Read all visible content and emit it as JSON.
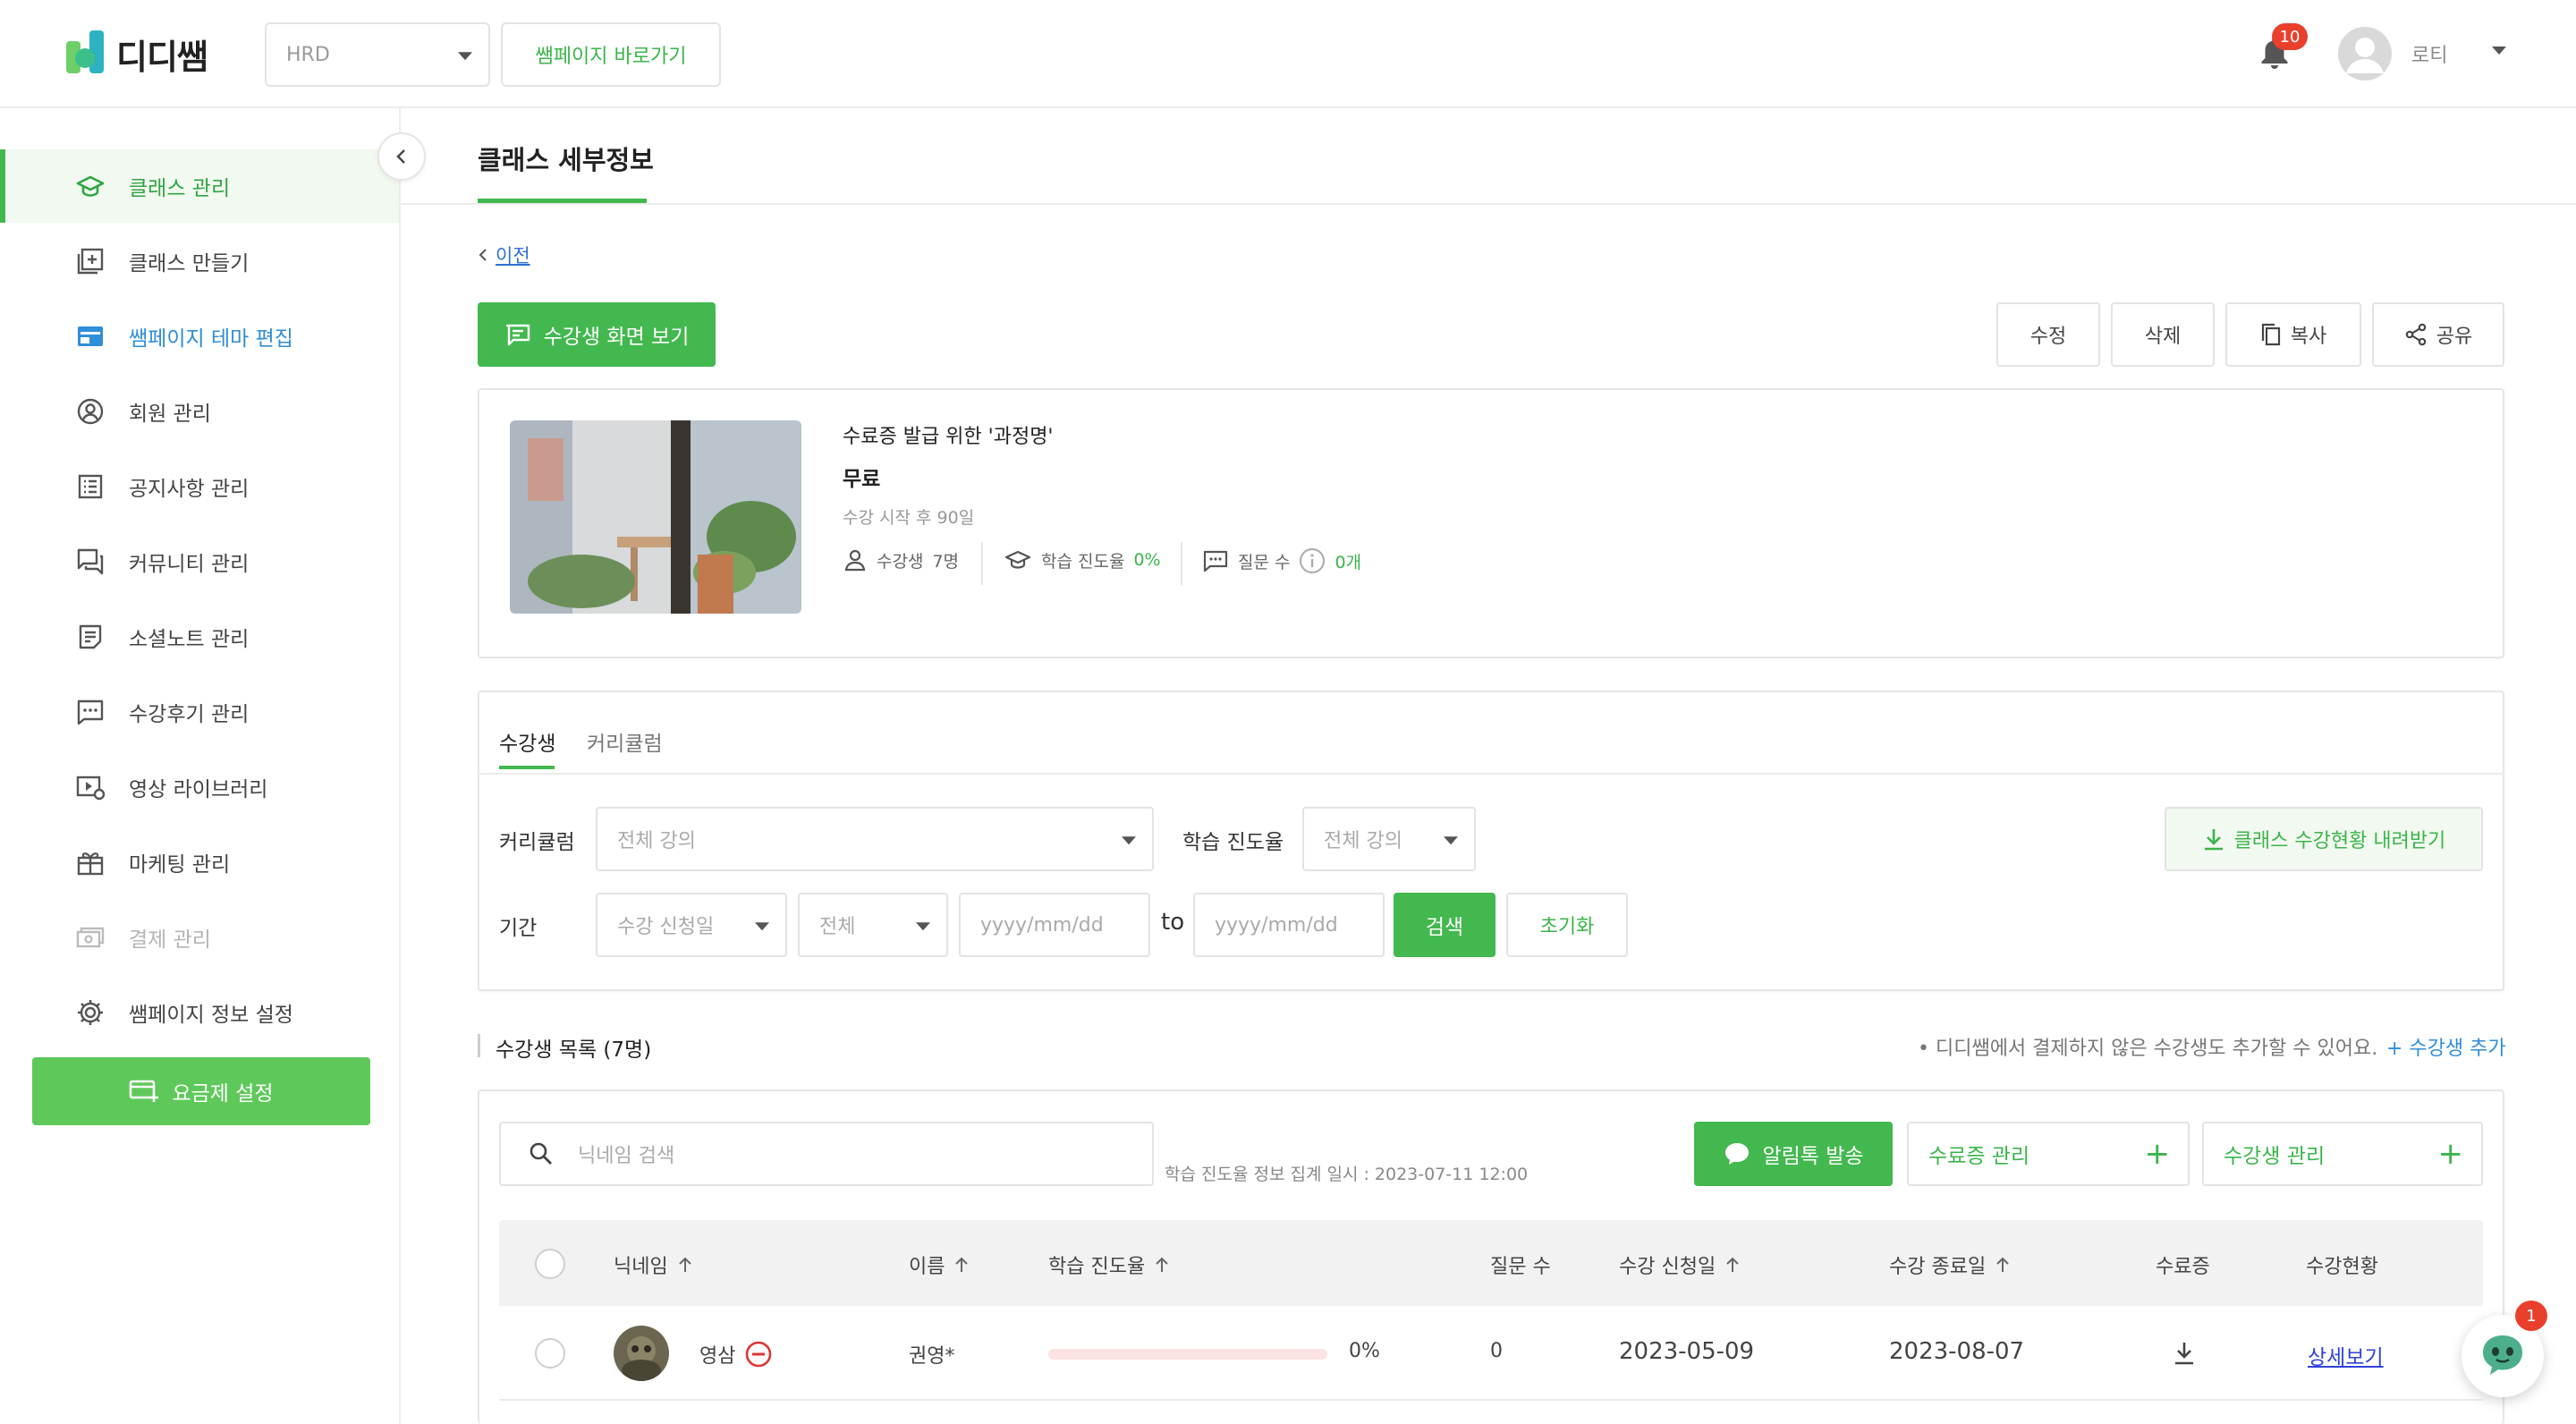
{
  "header": {
    "logo_text": "디디쌤",
    "org_select_value": "HRD",
    "sample_page_button": "쌤페이지 바로가기",
    "notification_count": "10",
    "user_name": "로티"
  },
  "sidebar": {
    "items": [
      {
        "label": "클래스 관리",
        "icon": "graduation-cap-icon",
        "state": "active"
      },
      {
        "label": "클래스 만들기",
        "icon": "add-square-icon",
        "state": "normal"
      },
      {
        "label": "쌤페이지 테마 편집",
        "icon": "web-layout-icon",
        "state": "highlight"
      },
      {
        "label": "회원 관리",
        "icon": "user-circle-icon",
        "state": "normal"
      },
      {
        "label": "공지사항 관리",
        "icon": "list-icon",
        "state": "normal"
      },
      {
        "label": "커뮤니티 관리",
        "icon": "chat-bubbles-icon",
        "state": "normal"
      },
      {
        "label": "소셜노트 관리",
        "icon": "note-icon",
        "state": "normal"
      },
      {
        "label": "수강후기 관리",
        "icon": "comment-icon",
        "state": "normal"
      },
      {
        "label": "영상 라이브러리",
        "icon": "video-library-icon",
        "state": "normal"
      },
      {
        "label": "마케팅 관리",
        "icon": "gift-icon",
        "state": "normal"
      },
      {
        "label": "결제 관리",
        "icon": "payment-icon",
        "state": "disabled"
      },
      {
        "label": "쌤페이지 정보 설정",
        "icon": "gear-icon",
        "state": "normal"
      }
    ],
    "plan_button": "요금제 설정"
  },
  "page": {
    "title": "클래스 세부정보",
    "back_label": "이전",
    "student_view_button": "수강생 화면 보기",
    "actions": {
      "edit": "수정",
      "delete": "삭제",
      "copy": "복사",
      "share": "공유"
    }
  },
  "course": {
    "title": "수료증 발급 위한 '과정명'",
    "price": "무료",
    "period": "수강 시작 후 90일",
    "students_label": "수강생",
    "students_value": "7명",
    "progress_label": "학습 진도율",
    "progress_value": "0%",
    "questions_label": "질문 수",
    "questions_value": "0개"
  },
  "tabs": [
    "수강생",
    "커리큘럼"
  ],
  "filters": {
    "curriculum_label": "커리큘럼",
    "curriculum_value": "전체 강의",
    "progress_label": "학습 진도율",
    "progress_value": "전체 강의",
    "download_button": "클래스 수강현황 내려받기",
    "period_label": "기간",
    "period_type": "수강 신청일",
    "period_range": "전체",
    "date_from_placeholder": "yyyy/mm/dd",
    "to_label": "to",
    "date_to_placeholder": "yyyy/mm/dd",
    "search_button": "검색",
    "reset_button": "초기화"
  },
  "list": {
    "title": "수강생 목록 (7명)",
    "note": "• 디디쌤에서 결제하지 않은 수강생도 추가할 수 있어요.",
    "add_link": "+ 수강생 추가",
    "search_placeholder": "닉네임 검색",
    "aggregate_time": "학습 진도율 정보 집계 일시 : 2023-07-11 12:00",
    "notify_button": "알림톡 발송",
    "certificate_button": "수료증 관리",
    "student_manage_button": "수강생 관리"
  },
  "table": {
    "columns": [
      "닉네임",
      "이름",
      "학습 진도율",
      "질문 수",
      "수강 신청일",
      "수강 종료일",
      "수료증",
      "수강현황"
    ],
    "rows": [
      {
        "nickname": "영삼",
        "name": "권영*",
        "progress": "0%",
        "progress_fraction": 0,
        "questions": "0",
        "start_date": "2023-05-09",
        "end_date": "2023-08-07",
        "detail": "상세보기"
      }
    ]
  },
  "chat": {
    "badge": "1"
  },
  "colors": {
    "brand_green": "#43b84f",
    "link_blue": "#2f8ed8",
    "badge_red": "#e8402d"
  }
}
